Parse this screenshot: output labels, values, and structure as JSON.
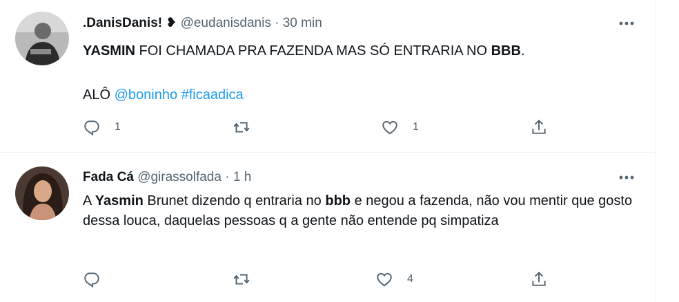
{
  "tweets": [
    {
      "display_name": ".DanisDanis! ❥",
      "handle": "@eudanisdanis",
      "separator": "·",
      "time": "30 min",
      "line1": {
        "bold_start": "YASMIN",
        "middle": " FOI CHAMADA PRA FAZENDA MAS SÓ ENTRARIA NO ",
        "bold_end": "BBB",
        "end": "."
      },
      "line2": {
        "prefix": "ALÔ ",
        "mention": "@boninho",
        "space": " ",
        "hashtag": "#ficaadica"
      },
      "replies": "1",
      "retweets": "",
      "likes": "1",
      "avatar_icon": "person-avatar-icon"
    },
    {
      "display_name": "Fada Cá",
      "handle": "@girassolfada",
      "separator": "·",
      "time": "1 h",
      "text": {
        "p1": "A ",
        "b1": "Yasmin",
        "p2": " Brunet dizendo q entraria no ",
        "b2": "bbb",
        "p3": " e negou a fazenda, não vou mentir que gosto dessa louca, daquelas pessoas q a gente não entende pq simpatiza"
      },
      "replies": "",
      "retweets": "",
      "likes": "4",
      "avatar_icon": "person-avatar-icon"
    }
  ],
  "colors": {
    "text": "#0f1419",
    "secondary": "#536471",
    "link": "#1d9bf0",
    "divider": "#eff3f4"
  },
  "icons": [
    "more-icon",
    "reply-icon",
    "retweet-icon",
    "like-icon",
    "share-icon"
  ]
}
